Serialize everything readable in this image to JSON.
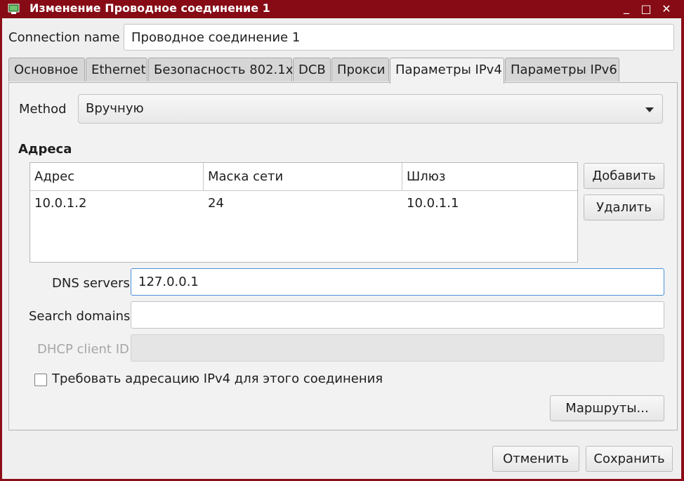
{
  "window": {
    "title": "Изменение Проводное соединение 1",
    "controls": {
      "minimize": "_",
      "maximize": "□",
      "close": "✕"
    }
  },
  "connection_name": {
    "label": "Connection name",
    "value": "Проводное соединение 1"
  },
  "tabs": [
    {
      "label": "Основное",
      "active": false
    },
    {
      "label": "Ethernet",
      "active": false
    },
    {
      "label": "Безопасность 802.1x",
      "active": false
    },
    {
      "label": "DCB",
      "active": false
    },
    {
      "label": "Прокси",
      "active": false
    },
    {
      "label": "Параметры IPv4",
      "active": true
    },
    {
      "label": "Параметры IPv6",
      "active": false
    }
  ],
  "ipv4": {
    "method": {
      "label": "Method",
      "value": "Вручную"
    },
    "addresses": {
      "heading": "Адреса",
      "columns": [
        "Адрес",
        "Маска сети",
        "Шлюз"
      ],
      "rows": [
        [
          "10.0.1.2",
          "24",
          "10.0.1.1"
        ]
      ],
      "add_button": "Добавить",
      "delete_button": "Удалить"
    },
    "dns_servers": {
      "label": "DNS servers",
      "value": "127.0.0.1"
    },
    "search_domains": {
      "label": "Search domains",
      "value": ""
    },
    "dhcp_client_id": {
      "label": "DHCP client ID",
      "value": ""
    },
    "require_ipv4": {
      "label": "Требовать адресацию IPv4 для этого соединения",
      "checked": false
    },
    "routes_button": "Маршруты..."
  },
  "footer": {
    "cancel_button": "Отменить",
    "save_button": "Сохранить"
  },
  "colors": {
    "titlebar": "#860b15",
    "focus": "#4a90d9"
  }
}
